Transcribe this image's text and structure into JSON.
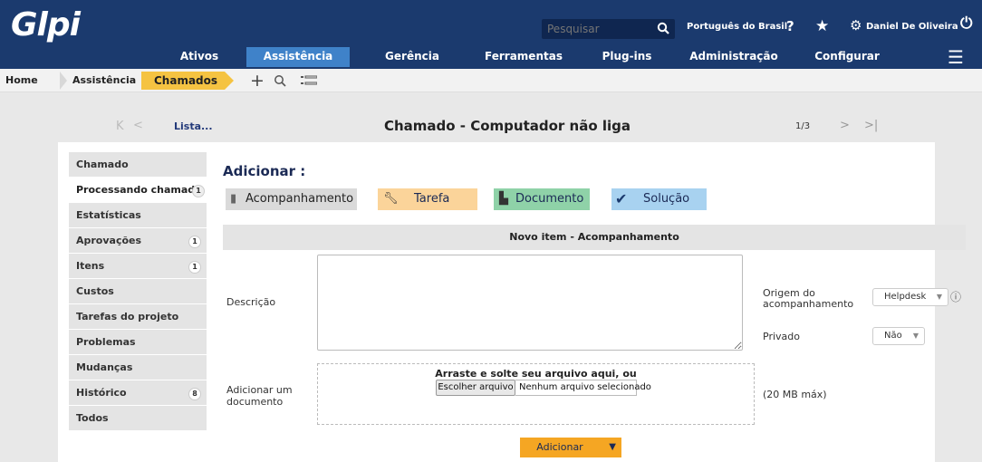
{
  "header": {
    "logo": "Glpi",
    "search_placeholder": "Pesquisar",
    "language": "Português do Brasil",
    "help": "?",
    "user": "Daniel De Oliveira"
  },
  "menu": {
    "items": [
      "Ativos",
      "Assistência",
      "Gerência",
      "Ferramentas",
      "Plug-ins",
      "Administração",
      "Configurar"
    ],
    "active": "Assistência"
  },
  "breadcrumb": {
    "home": "Home",
    "section": "Assistência",
    "current": "Chamados"
  },
  "nav": {
    "first": "K",
    "prev": "<",
    "list": "Lista...",
    "title": "Chamado - Computador não liga",
    "count": "1/3",
    "next": ">",
    "last": ">|"
  },
  "sidebar": {
    "items": [
      {
        "label": "Chamado",
        "badge": ""
      },
      {
        "label": "Processando chamado",
        "badge": "1"
      },
      {
        "label": "Estatísticas",
        "badge": ""
      },
      {
        "label": "Aprovações",
        "badge": "1"
      },
      {
        "label": "Itens",
        "badge": "1"
      },
      {
        "label": "Custos",
        "badge": ""
      },
      {
        "label": "Tarefas do projeto",
        "badge": ""
      },
      {
        "label": "Problemas",
        "badge": ""
      },
      {
        "label": "Mudanças",
        "badge": ""
      },
      {
        "label": "Histórico",
        "badge": "8"
      },
      {
        "label": "Todos",
        "badge": ""
      }
    ],
    "active_index": 1
  },
  "form": {
    "heading": "Adicionar :",
    "actions": {
      "acompanhamento": "Acompanhamento",
      "tarefa": "Tarefa",
      "documento": "Documento",
      "solucao": "Solução"
    },
    "section_title": "Novo item - Acompanhamento",
    "descricao_label": "Descrição",
    "origem_label": "Origem do acompanhamento",
    "origem_value": "Helpdesk",
    "privado_label": "Privado",
    "privado_value": "Não",
    "documento_label": "Adicionar um documento",
    "dropzone_text": "Arraste e solte seu arquivo aqui, ou",
    "file_button": "Escolher arquivo",
    "file_status": "Nenhum arquivo selecionado",
    "max_size": "(20 MB máx)",
    "submit": "Adicionar"
  },
  "colors": {
    "header_bg": "#1b3a6e",
    "menu_active": "#3f82c9",
    "breadcrumb_current": "#f5c342",
    "btn_acompanhamento": "#dadada",
    "btn_tarefa": "#fbd49a",
    "btn_documento": "#8fd2a8",
    "btn_solucao": "#a8d2f0",
    "btn_submit": "#f5a623"
  }
}
